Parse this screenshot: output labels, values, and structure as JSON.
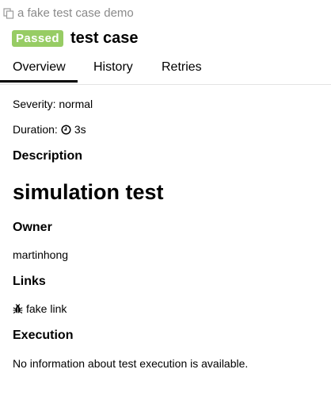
{
  "breadcrumb": {
    "text": "a fake test case demo"
  },
  "header": {
    "status": "Passed",
    "title": "test case",
    "status_color": "#97cc64"
  },
  "tabs": [
    {
      "label": "Overview",
      "active": true
    },
    {
      "label": "History",
      "active": false
    },
    {
      "label": "Retries",
      "active": false
    }
  ],
  "overview": {
    "severity": "Severity: normal",
    "duration_prefix": "Duration:",
    "duration_value": "3s",
    "description_heading": "Description",
    "description_body": "simulation test",
    "owner_heading": "Owner",
    "owner_value": "martinhong",
    "links_heading": "Links",
    "link_label": "fake link",
    "execution_heading": "Execution",
    "execution_body": "No information about test execution is available."
  },
  "icons": {
    "breadcrumb": "copy-icon",
    "duration": "clock-icon",
    "link": "bug-icon"
  }
}
